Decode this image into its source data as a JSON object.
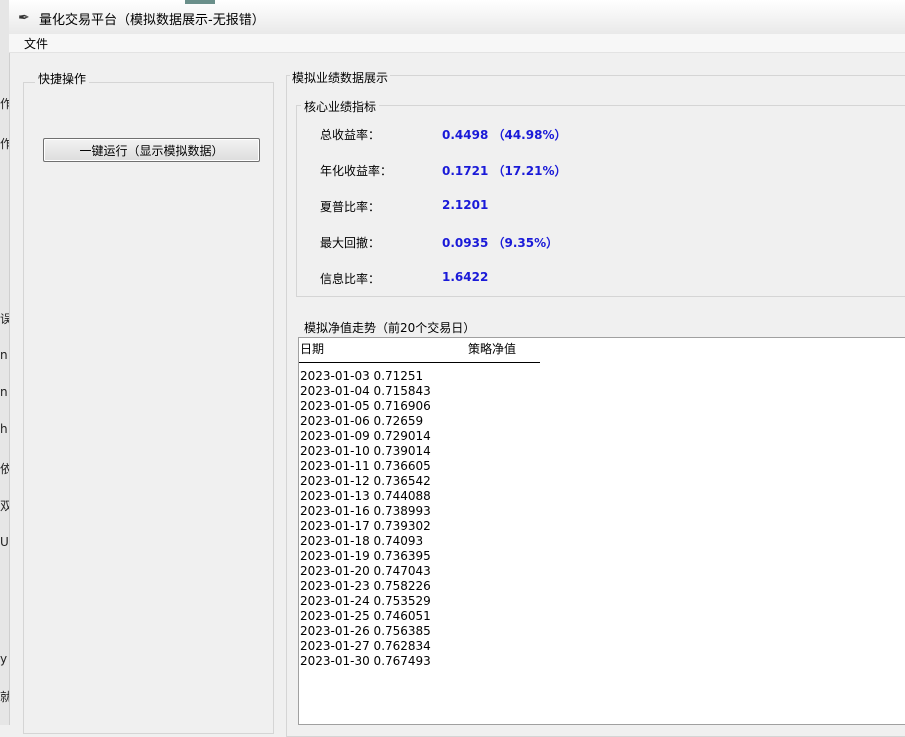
{
  "window": {
    "title": "量化交易平台（模拟数据展示-无报错）",
    "icon": "feather-icon"
  },
  "menu": {
    "file": "文件"
  },
  "left_panel": {
    "title": "快捷操作",
    "run_button": "一键运行（显示模拟数据）"
  },
  "right_panel": {
    "title": "模拟业绩数据展示",
    "metrics_title": "核心业绩指标",
    "metrics": [
      {
        "label": "总收益率：",
        "value": "0.4498 （44.98%）"
      },
      {
        "label": "年化收益率：",
        "value": "0.1721 （17.21%）"
      },
      {
        "label": "夏普比率：",
        "value": "2.1201"
      },
      {
        "label": "最大回撤：",
        "value": "0.0935 （9.35%）"
      },
      {
        "label": "信息比率：",
        "value": "1.6422"
      }
    ],
    "nav_title": "模拟净值走势（前20个交易日）",
    "nav_headers": {
      "date": "日期",
      "nav": "策略净值"
    },
    "nav_rows": [
      "2023-01-03 0.71251",
      "2023-01-04 0.715843",
      "2023-01-05 0.716906",
      "2023-01-06 0.72659",
      "2023-01-09 0.729014",
      "2023-01-10 0.739014",
      "2023-01-11 0.736605",
      "2023-01-12 0.736542",
      "2023-01-13 0.744088",
      "2023-01-16 0.738993",
      "2023-01-17 0.739302",
      "2023-01-18 0.74093",
      "2023-01-19 0.736395",
      "2023-01-20 0.747043",
      "2023-01-23 0.758226",
      "2023-01-24 0.753529",
      "2023-01-25 0.746051",
      "2023-01-26 0.756385",
      "2023-01-27 0.762834",
      "2023-01-30 0.767493"
    ]
  },
  "behind_window_glyphs": [
    "作",
    "作",
    "误",
    "n",
    "n",
    "h",
    "依",
    "双",
    "U",
    "y",
    "就"
  ],
  "colors": {
    "metric_value": "#1a1ad8",
    "background": "#f0f0f0"
  }
}
